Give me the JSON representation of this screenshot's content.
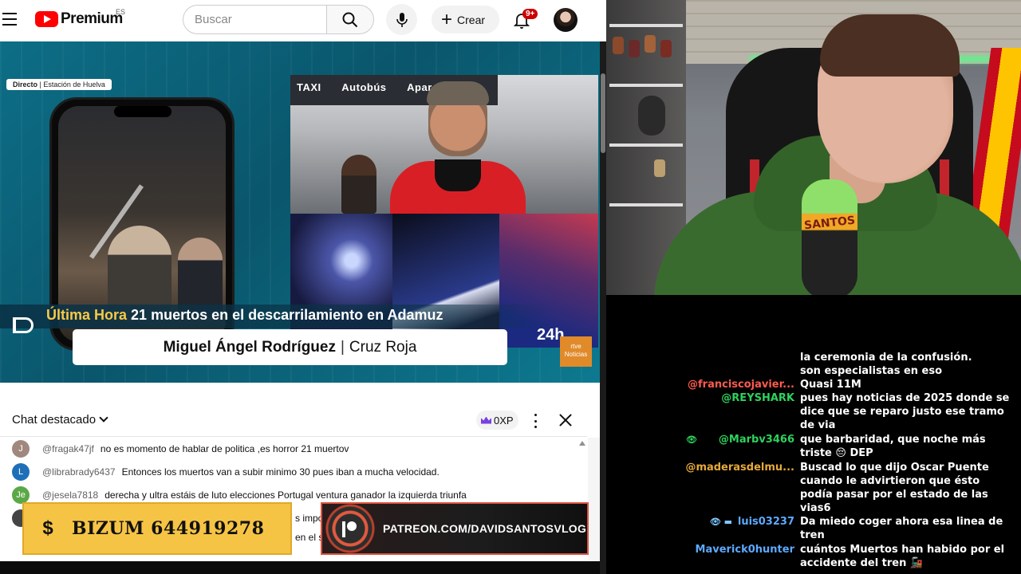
{
  "youtube": {
    "logo_text": "Premium",
    "country": "ES",
    "search_placeholder": "Buscar",
    "create_label": "Crear",
    "notif_count": "9+"
  },
  "video": {
    "live_tag_prefix": "Directo",
    "live_tag_rest": "| Estación de Huelva",
    "sign_items": [
      "TAXI",
      "Autobús",
      "Aparcamiento"
    ],
    "headline_prefix": "Última Hora",
    "headline_text": "21 muertos en el descarrilamiento en Adamuz",
    "name": "Miguel Ángel Rodríguez",
    "org": "Cruz Roja",
    "channel_number": "24h",
    "channel_logo": "rtve Noticias"
  },
  "chat": {
    "title": "Chat destacado",
    "xp": "0XP",
    "messages": [
      {
        "initial": "J",
        "color": "#a1887f",
        "author": "@fragak47jf",
        "text": "no es momento de hablar de politica ,es horror 21 muertov"
      },
      {
        "initial": "L",
        "color": "#1e6fb8",
        "author": "@librabrady6437",
        "text": "Entonces los muertos van a subir minimo 30 pues iban a mucha velocidad."
      },
      {
        "initial": "Je",
        "color": "#5aa846",
        "author": "@jesela7818",
        "text": "derecha y ultra estáis de luto elecciones Portugal ventura ganador la izquierda triunfa"
      },
      {
        "initial": "",
        "color": "#444444",
        "author": "",
        "text": "s impo"
      },
      {
        "initial": "",
        "color": "#ffffff",
        "author": "",
        "text": "en el s"
      }
    ]
  },
  "overlays": {
    "bizum_symbol": "$",
    "bizum_label": "BIZUM 644919278",
    "patreon_label": "PATREON.COM/DAVIDSANTOSVLOG"
  },
  "cam": {
    "mic_brand": "SANTOS"
  },
  "stream_chat": [
    {
      "user": "",
      "color": "#5da9ff",
      "text": "la ceremonia de la confusión."
    },
    {
      "user": "",
      "color": "#5da9ff",
      "text": "son especialistas en eso"
    },
    {
      "user": "@franciscojavier...",
      "color": "#ff5a4f",
      "text": "Quasi 11M"
    },
    {
      "user": "@REYSHARK",
      "color": "#2ed15d",
      "text": "pues hay noticias de 2025 donde se dice que se reparo justo ese tramo de via"
    },
    {
      "user": "@Marbv3466",
      "color": "#2ed15d",
      "badge": "👁",
      "text": "que barbaridad, que noche más triste 😔 DEP"
    },
    {
      "user": "@maderasdelmu...",
      "color": "#e6a93a",
      "text": "Buscad lo que dijo Oscar Puente cuando le advirtieron que ésto podía pasar por el estado de las vias6"
    },
    {
      "user": "luis03237",
      "color": "#5da9ff",
      "badge": "👁 ▬",
      "text": "Da miedo coger ahora esa linea de tren"
    },
    {
      "user": "Maverick0hunter",
      "color": "#5da9ff",
      "text": "cuántos Muertos han habido por el accidente del tren 🚂"
    }
  ]
}
